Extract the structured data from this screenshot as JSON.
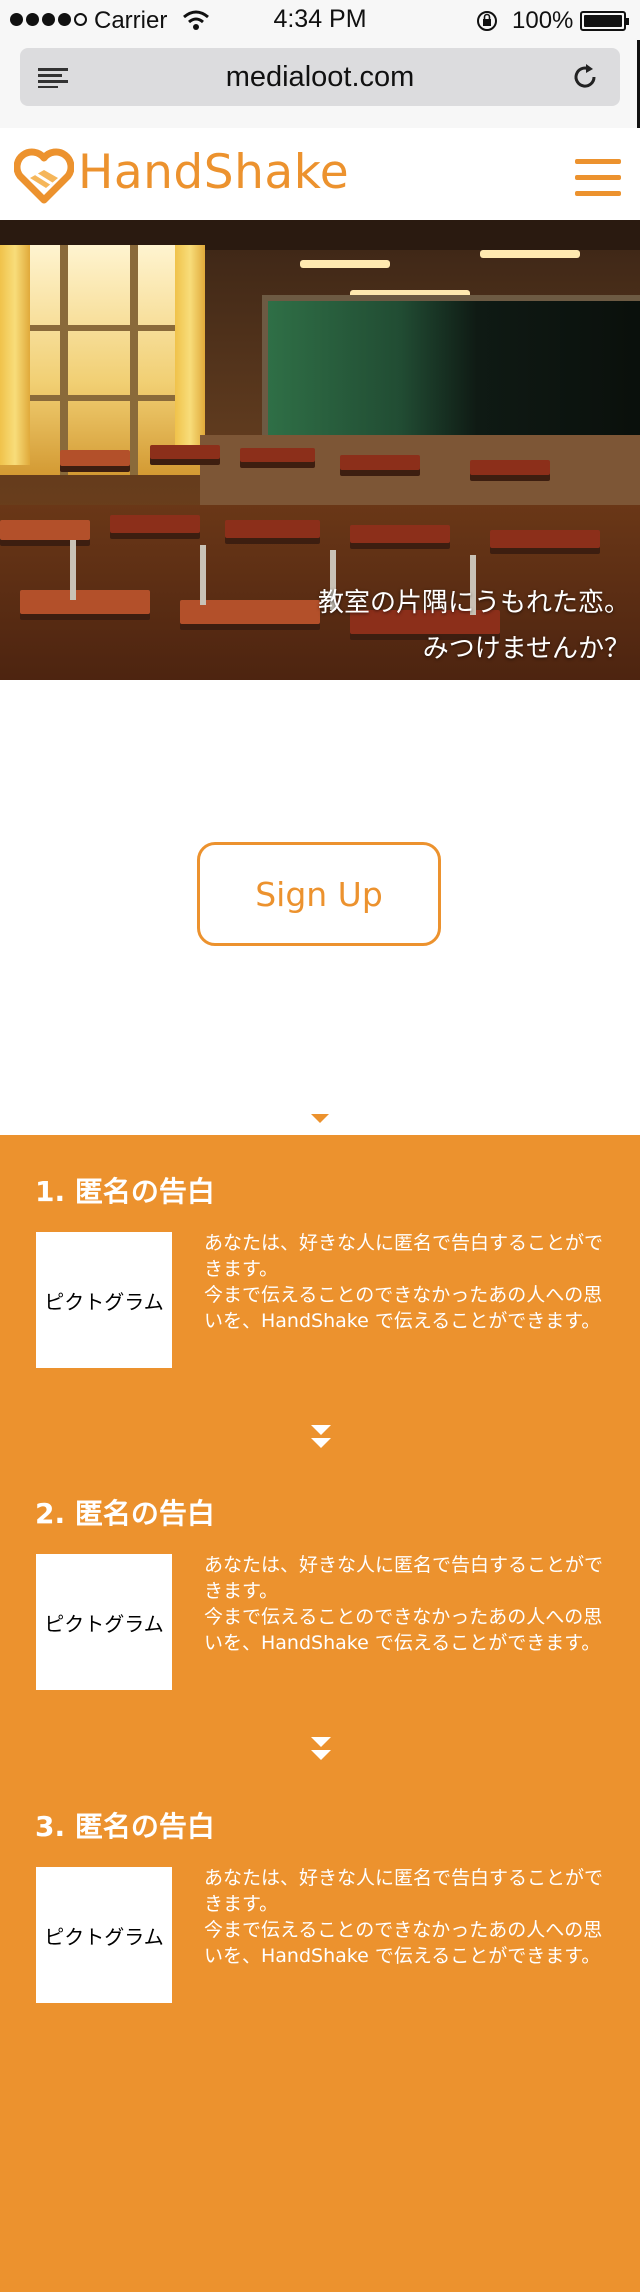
{
  "status_bar": {
    "carrier": "Carrier",
    "time": "4:34 PM",
    "battery": "100%"
  },
  "browser": {
    "url": "medialoot.com",
    "icons": [
      "reader-list-icon",
      "reload-icon"
    ]
  },
  "header": {
    "logo_text": "HandShake",
    "brand_color": "#ec922e",
    "menu_icon": "hamburger-menu-icon"
  },
  "hero": {
    "caption_line1": "教室の片隅にうもれた恋。",
    "caption_line2": "みつけませんか？"
  },
  "signup": {
    "label": "Sign Up"
  },
  "steps": [
    {
      "title": "1. 匿名の告白",
      "pictogram": "ピクトグラム",
      "desc_line1": "あなたは、好きな人に匿名で告白することができます。",
      "desc_line2": "今まで伝えることのできなかったあの人への思いを、HandShake で伝えることができます。"
    },
    {
      "title": "2. 匿名の告白",
      "pictogram": "ピクトグラム",
      "desc_line1": "あなたは、好きな人に匿名で告白することができます。",
      "desc_line2": "今まで伝えることのできなかったあの人への思いを、HandShake で伝えることができます。"
    },
    {
      "title": "3. 匿名の告白",
      "pictogram": "ピクトグラム",
      "desc_line1": "あなたは、好きな人に匿名で告白することができます。",
      "desc_line2": "今まで伝えることのできなかったあの人への思いを、HandShake で伝えることができます。"
    }
  ],
  "colors": {
    "accent": "#ec922e",
    "section_bg": "#ec922e",
    "text_on_accent": "#ffffff"
  }
}
